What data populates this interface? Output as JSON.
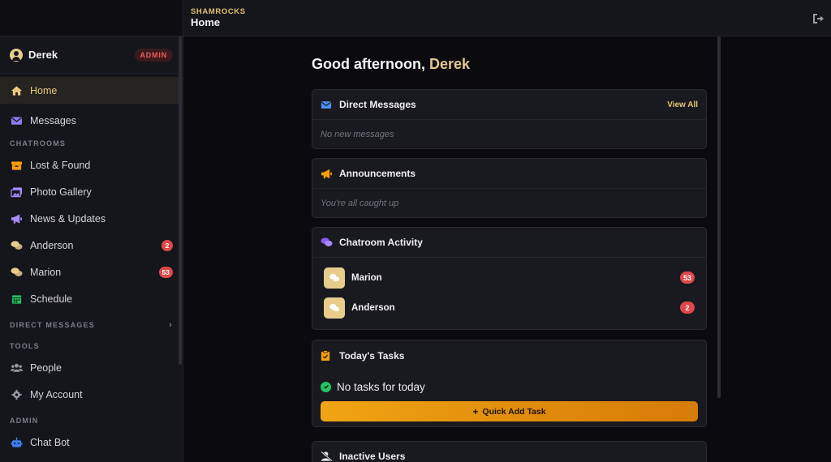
{
  "header": {
    "brand": "SHAMROCKS",
    "title": "Home"
  },
  "sidebar": {
    "user": {
      "name": "Derek",
      "badge": "ADMIN"
    },
    "items": [
      {
        "label": "Home",
        "icon": "home-icon"
      },
      {
        "label": "Messages",
        "icon": "envelope-icon"
      }
    ],
    "section_chatrooms": "CHATROOMS",
    "chatrooms": [
      {
        "label": "Lost & Found",
        "icon": "box-icon"
      },
      {
        "label": "Photo Gallery",
        "icon": "images-icon"
      },
      {
        "label": "News & Updates",
        "icon": "megaphone-icon"
      },
      {
        "label": "Anderson",
        "icon": "comments-icon",
        "count": "2"
      },
      {
        "label": "Marion",
        "icon": "comments-icon",
        "count": "53"
      },
      {
        "label": "Schedule",
        "icon": "calendar-icon"
      }
    ],
    "section_dm": "DIRECT MESSAGES",
    "section_tools": "TOOLS",
    "tools": [
      {
        "label": "People",
        "icon": "users-icon"
      },
      {
        "label": "My Account",
        "icon": "gear-icon"
      }
    ],
    "section_admin": "ADMIN",
    "admin": [
      {
        "label": "Chat Bot",
        "icon": "robot-icon"
      }
    ]
  },
  "main": {
    "greeting_prefix": "Good afternoon, ",
    "greeting_name": "Derek",
    "direct_messages": {
      "title": "Direct Messages",
      "action": "View All",
      "empty": "No new messages"
    },
    "announcements": {
      "title": "Announcements",
      "empty": "You're all caught up"
    },
    "chatroom_activity": {
      "title": "Chatroom Activity",
      "rooms": [
        {
          "name": "Marion",
          "count": "53"
        },
        {
          "name": "Anderson",
          "count": "2"
        }
      ]
    },
    "tasks": {
      "title": "Today's Tasks",
      "empty": "No tasks for today",
      "button": "Quick Add Task"
    },
    "inactive_users": {
      "title": "Inactive Users"
    }
  },
  "colors": {
    "accent": "#e0c171",
    "badge_red": "#e04848",
    "button_orange": "#f0a413",
    "sidebar_bg": "#15151c",
    "page_bg": "#0b0b0f"
  }
}
